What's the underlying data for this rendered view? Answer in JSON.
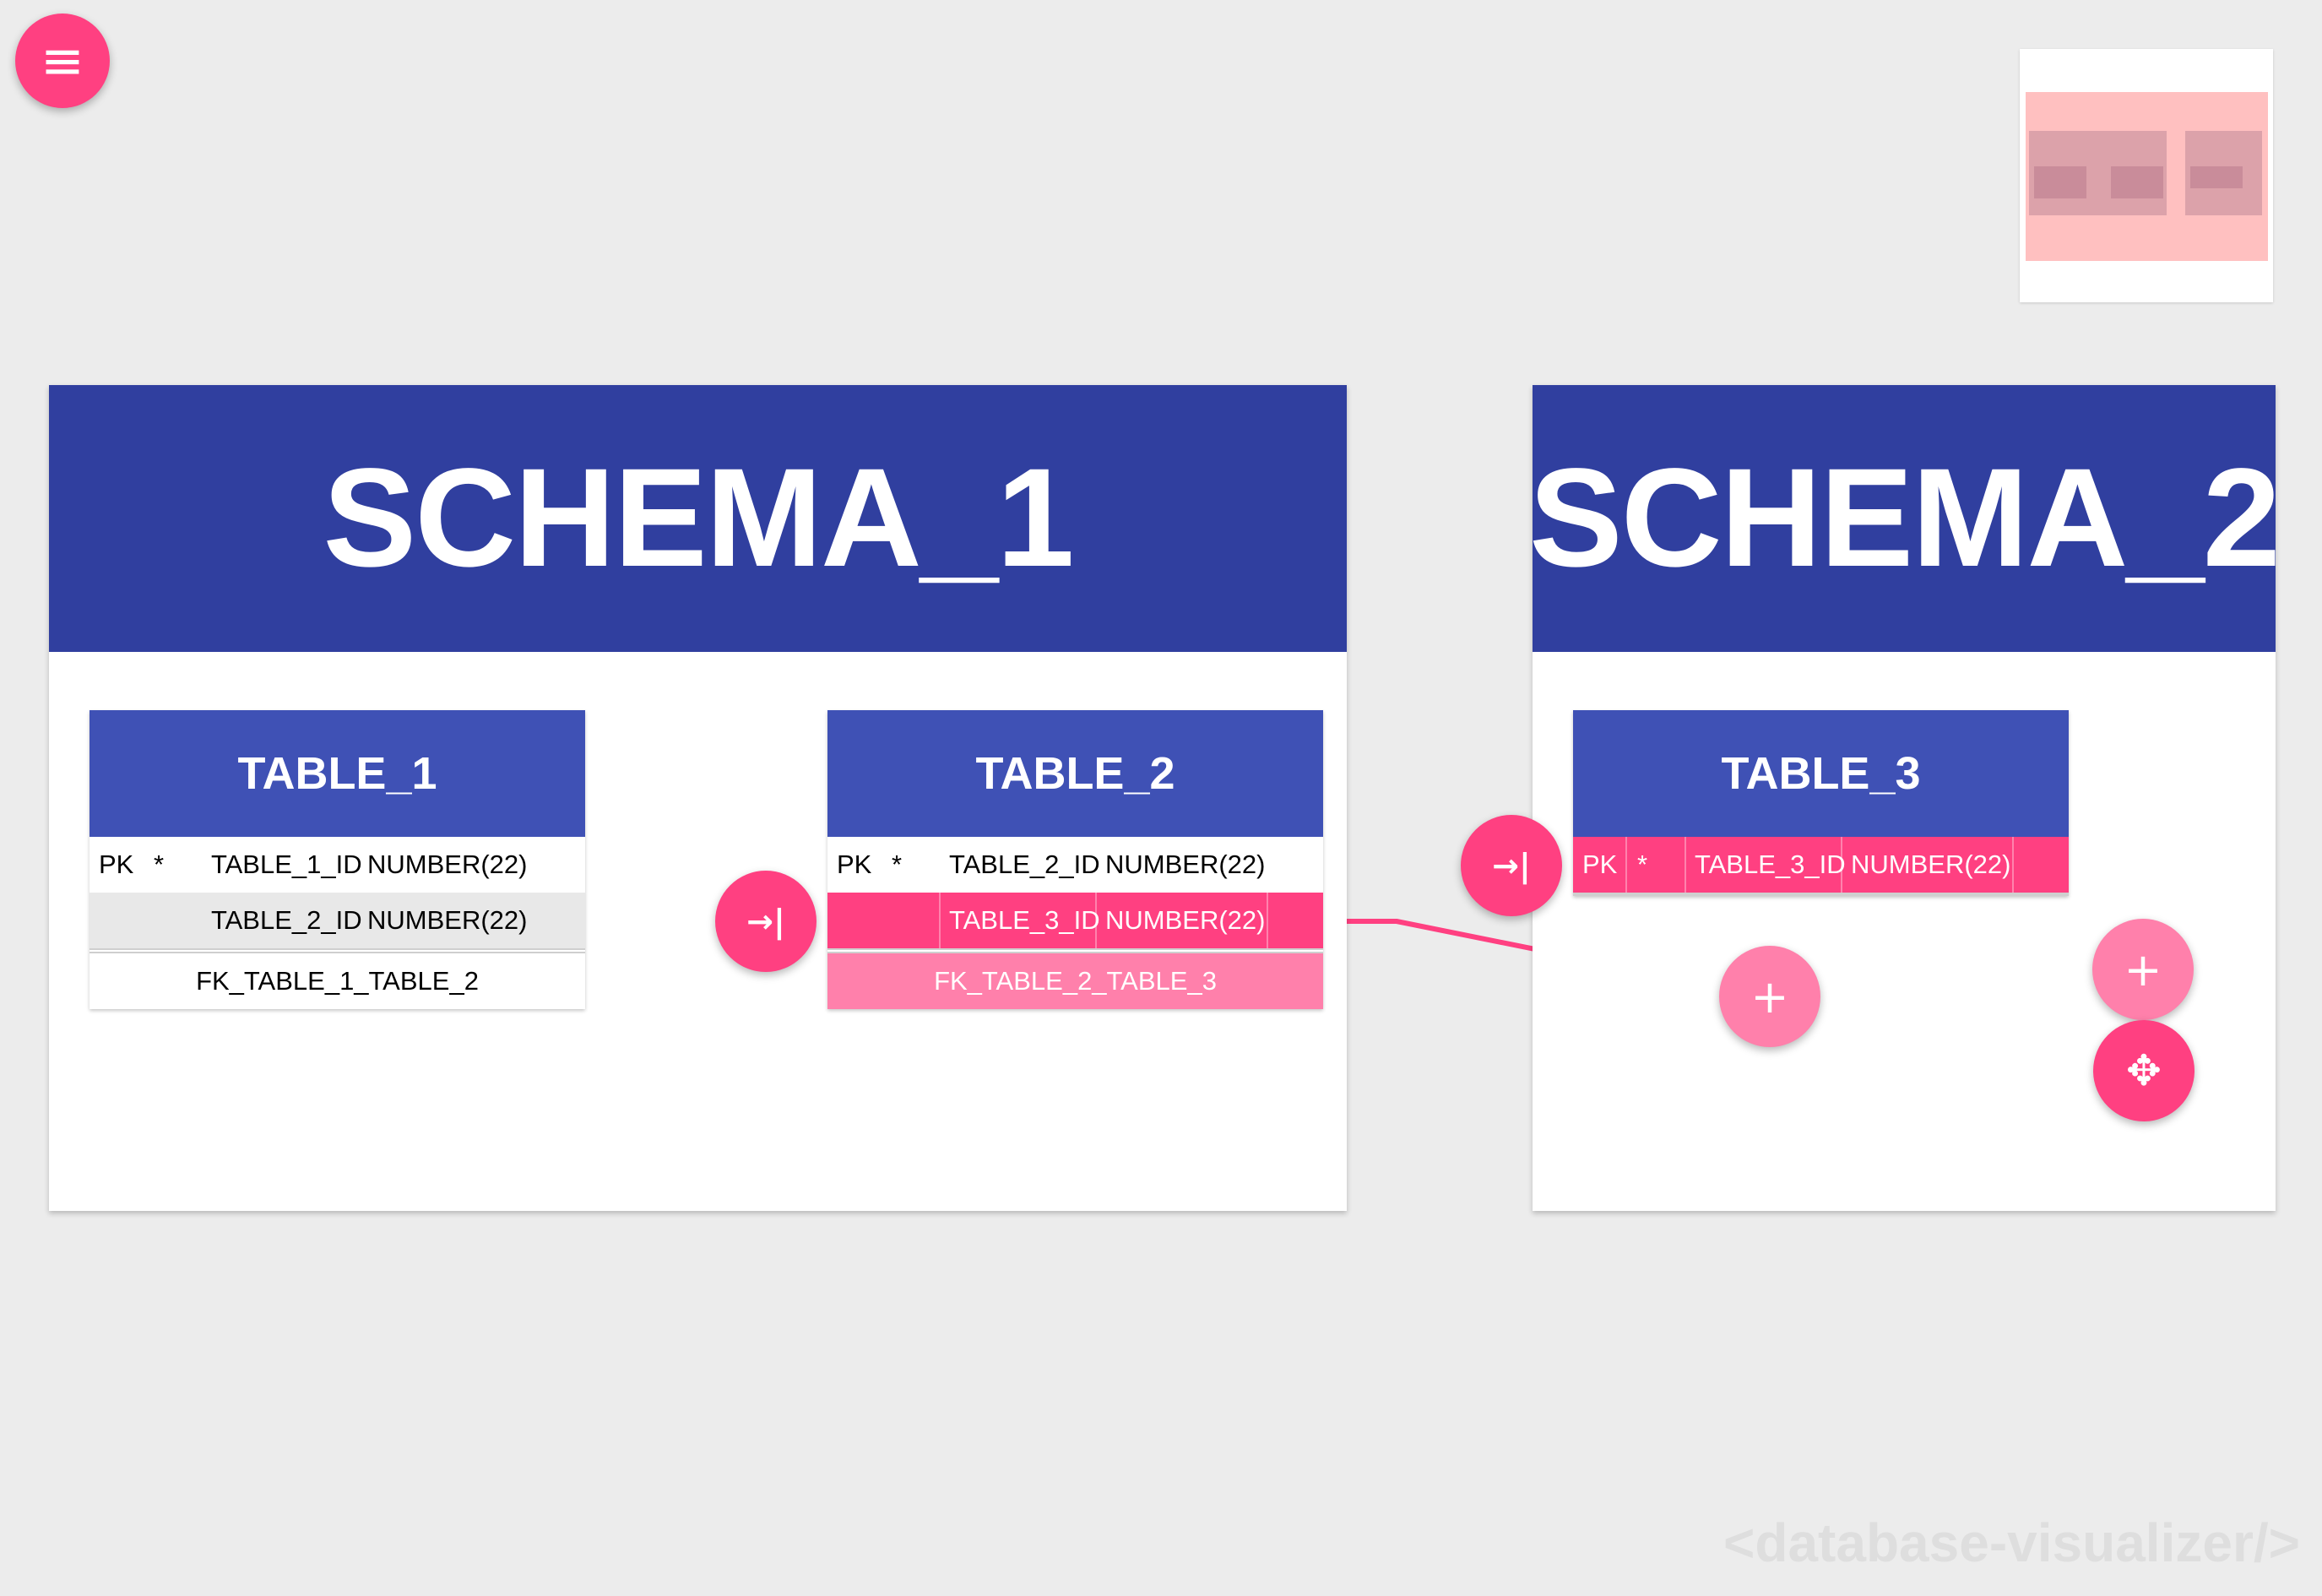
{
  "app": {
    "watermark": "<database-visualizer/>"
  },
  "menu_button": {
    "icon": "menu-icon"
  },
  "schemas": [
    {
      "title": "SCHEMA_1",
      "tables": [
        {
          "name": "TABLE_1",
          "columns": [
            {
              "key": "PK",
              "required": "*",
              "name": "TABLE_1_ID",
              "type": "NUMBER(22)"
            },
            {
              "key": "",
              "required": "",
              "name": "TABLE_2_ID",
              "type": "NUMBER(22)"
            }
          ],
          "foreign_keys": [
            "FK_TABLE_1_TABLE_2"
          ]
        },
        {
          "name": "TABLE_2",
          "columns": [
            {
              "key": "PK",
              "required": "*",
              "name": "TABLE_2_ID",
              "type": "NUMBER(22)"
            },
            {
              "key": "",
              "required": "",
              "name": "TABLE_3_ID",
              "type": "NUMBER(22)",
              "selected": true
            }
          ],
          "foreign_keys": [
            "FK_TABLE_2_TABLE_3"
          ]
        }
      ]
    },
    {
      "title": "SCHEMA_2",
      "tables": [
        {
          "name": "TABLE_3",
          "columns": [
            {
              "key": "PK",
              "required": "*",
              "name": "TABLE_3_ID",
              "type": "NUMBER(22)",
              "selected": true
            }
          ],
          "foreign_keys": []
        }
      ]
    }
  ],
  "relations": [
    {
      "name": "FK_TABLE_1_TABLE_2",
      "from": "TABLE_1.TABLE_2_ID",
      "to": "TABLE_2.TABLE_2_ID",
      "selected": false
    },
    {
      "name": "FK_TABLE_2_TABLE_3",
      "from": "TABLE_2.TABLE_3_ID",
      "to": "TABLE_3.TABLE_3_ID",
      "selected": true
    }
  ],
  "controls": {
    "go_to_target_icon": "arrow-to-bar-icon",
    "add_point_icon": "plus-icon",
    "move_icon": "move-arrows-icon",
    "go_to_target_glyph": "→|",
    "add_point_glyph": "+",
    "move_glyph": "✥",
    "menu_glyph": "≡"
  },
  "colors": {
    "background": "#ececec",
    "schema_header": "#303f9f",
    "table_header": "#3f51b5",
    "accent": "#ff4081",
    "accent_light": "#ff80ab",
    "link_default": "#000000"
  }
}
